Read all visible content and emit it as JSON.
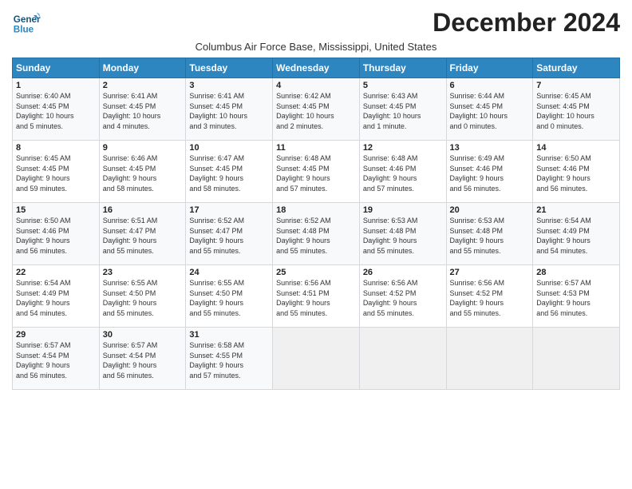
{
  "header": {
    "logo_line1": "General",
    "logo_line2": "Blue",
    "title": "December 2024",
    "subtitle": "Columbus Air Force Base, Mississippi, United States"
  },
  "weekdays": [
    "Sunday",
    "Monday",
    "Tuesday",
    "Wednesday",
    "Thursday",
    "Friday",
    "Saturday"
  ],
  "weeks": [
    [
      {
        "day": "1",
        "info": "Sunrise: 6:40 AM\nSunset: 4:45 PM\nDaylight: 10 hours\nand 5 minutes."
      },
      {
        "day": "2",
        "info": "Sunrise: 6:41 AM\nSunset: 4:45 PM\nDaylight: 10 hours\nand 4 minutes."
      },
      {
        "day": "3",
        "info": "Sunrise: 6:41 AM\nSunset: 4:45 PM\nDaylight: 10 hours\nand 3 minutes."
      },
      {
        "day": "4",
        "info": "Sunrise: 6:42 AM\nSunset: 4:45 PM\nDaylight: 10 hours\nand 2 minutes."
      },
      {
        "day": "5",
        "info": "Sunrise: 6:43 AM\nSunset: 4:45 PM\nDaylight: 10 hours\nand 1 minute."
      },
      {
        "day": "6",
        "info": "Sunrise: 6:44 AM\nSunset: 4:45 PM\nDaylight: 10 hours\nand 0 minutes."
      },
      {
        "day": "7",
        "info": "Sunrise: 6:45 AM\nSunset: 4:45 PM\nDaylight: 10 hours\nand 0 minutes."
      }
    ],
    [
      {
        "day": "8",
        "info": "Sunrise: 6:45 AM\nSunset: 4:45 PM\nDaylight: 9 hours\nand 59 minutes."
      },
      {
        "day": "9",
        "info": "Sunrise: 6:46 AM\nSunset: 4:45 PM\nDaylight: 9 hours\nand 58 minutes."
      },
      {
        "day": "10",
        "info": "Sunrise: 6:47 AM\nSunset: 4:45 PM\nDaylight: 9 hours\nand 58 minutes."
      },
      {
        "day": "11",
        "info": "Sunrise: 6:48 AM\nSunset: 4:45 PM\nDaylight: 9 hours\nand 57 minutes."
      },
      {
        "day": "12",
        "info": "Sunrise: 6:48 AM\nSunset: 4:46 PM\nDaylight: 9 hours\nand 57 minutes."
      },
      {
        "day": "13",
        "info": "Sunrise: 6:49 AM\nSunset: 4:46 PM\nDaylight: 9 hours\nand 56 minutes."
      },
      {
        "day": "14",
        "info": "Sunrise: 6:50 AM\nSunset: 4:46 PM\nDaylight: 9 hours\nand 56 minutes."
      }
    ],
    [
      {
        "day": "15",
        "info": "Sunrise: 6:50 AM\nSunset: 4:46 PM\nDaylight: 9 hours\nand 56 minutes."
      },
      {
        "day": "16",
        "info": "Sunrise: 6:51 AM\nSunset: 4:47 PM\nDaylight: 9 hours\nand 55 minutes."
      },
      {
        "day": "17",
        "info": "Sunrise: 6:52 AM\nSunset: 4:47 PM\nDaylight: 9 hours\nand 55 minutes."
      },
      {
        "day": "18",
        "info": "Sunrise: 6:52 AM\nSunset: 4:48 PM\nDaylight: 9 hours\nand 55 minutes."
      },
      {
        "day": "19",
        "info": "Sunrise: 6:53 AM\nSunset: 4:48 PM\nDaylight: 9 hours\nand 55 minutes."
      },
      {
        "day": "20",
        "info": "Sunrise: 6:53 AM\nSunset: 4:48 PM\nDaylight: 9 hours\nand 55 minutes."
      },
      {
        "day": "21",
        "info": "Sunrise: 6:54 AM\nSunset: 4:49 PM\nDaylight: 9 hours\nand 54 minutes."
      }
    ],
    [
      {
        "day": "22",
        "info": "Sunrise: 6:54 AM\nSunset: 4:49 PM\nDaylight: 9 hours\nand 54 minutes."
      },
      {
        "day": "23",
        "info": "Sunrise: 6:55 AM\nSunset: 4:50 PM\nDaylight: 9 hours\nand 55 minutes."
      },
      {
        "day": "24",
        "info": "Sunrise: 6:55 AM\nSunset: 4:50 PM\nDaylight: 9 hours\nand 55 minutes."
      },
      {
        "day": "25",
        "info": "Sunrise: 6:56 AM\nSunset: 4:51 PM\nDaylight: 9 hours\nand 55 minutes."
      },
      {
        "day": "26",
        "info": "Sunrise: 6:56 AM\nSunset: 4:52 PM\nDaylight: 9 hours\nand 55 minutes."
      },
      {
        "day": "27",
        "info": "Sunrise: 6:56 AM\nSunset: 4:52 PM\nDaylight: 9 hours\nand 55 minutes."
      },
      {
        "day": "28",
        "info": "Sunrise: 6:57 AM\nSunset: 4:53 PM\nDaylight: 9 hours\nand 56 minutes."
      }
    ],
    [
      {
        "day": "29",
        "info": "Sunrise: 6:57 AM\nSunset: 4:54 PM\nDaylight: 9 hours\nand 56 minutes."
      },
      {
        "day": "30",
        "info": "Sunrise: 6:57 AM\nSunset: 4:54 PM\nDaylight: 9 hours\nand 56 minutes."
      },
      {
        "day": "31",
        "info": "Sunrise: 6:58 AM\nSunset: 4:55 PM\nDaylight: 9 hours\nand 57 minutes."
      },
      null,
      null,
      null,
      null
    ]
  ]
}
